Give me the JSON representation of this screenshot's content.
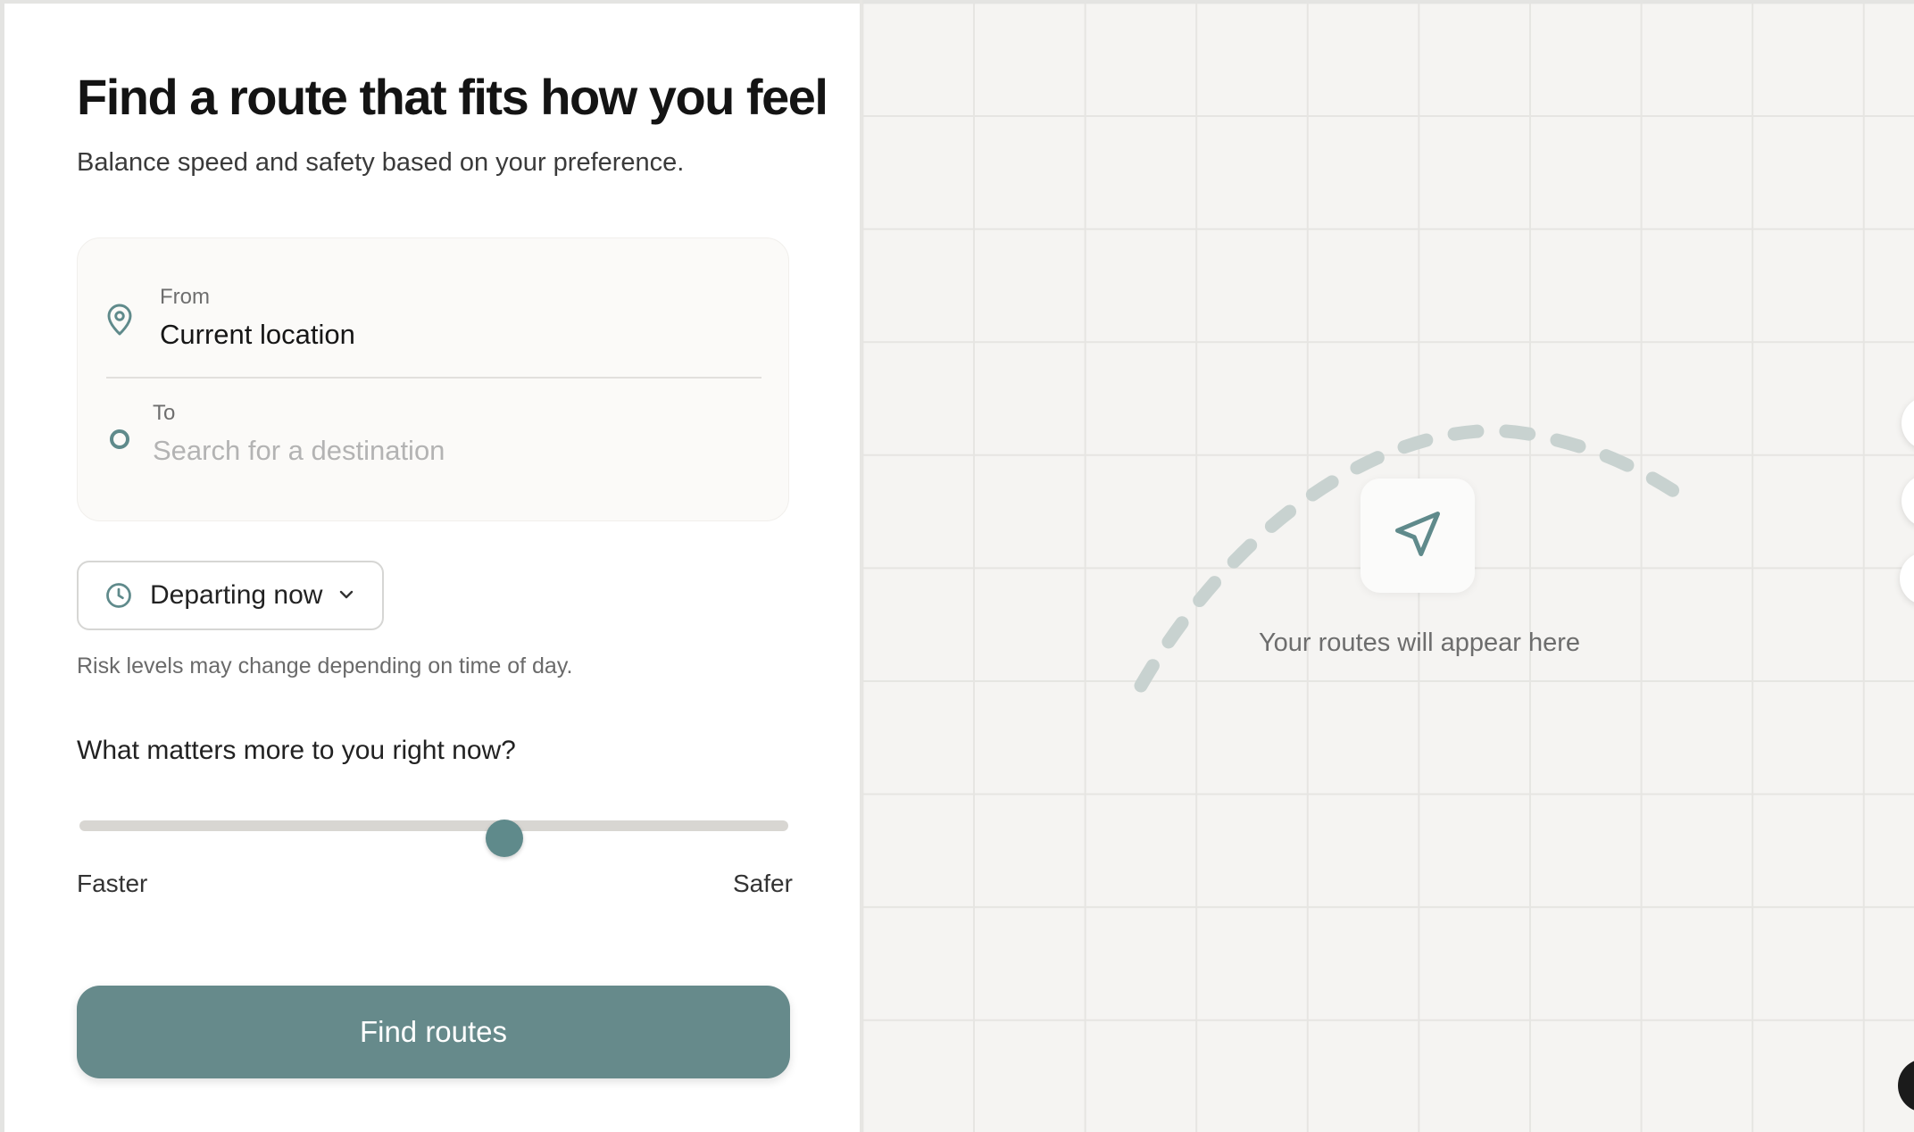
{
  "header": {
    "title": "Find a route that fits how you feel",
    "subtitle": "Balance speed and safety based on your preference."
  },
  "locations": {
    "from_label": "From",
    "from_value": "Current location",
    "to_label": "To",
    "to_placeholder": "Search for a destination",
    "icons": {
      "from": "location-pin-icon",
      "to": "destination-circle-icon"
    }
  },
  "departure": {
    "selected": "Departing now",
    "note": "Risk levels may change depending on time of day.",
    "icons": {
      "clock": "clock-icon",
      "chevron": "chevron-down-icon"
    }
  },
  "preference": {
    "question": "What matters more to you right now?",
    "min_label": "Faster",
    "max_label": "Safer",
    "value_fraction": 0.6
  },
  "actions": {
    "find_routes": "Find routes"
  },
  "map": {
    "empty_message": "Your routes will appear here",
    "icon": "navigation-arrow-icon"
  },
  "colors": {
    "accent": "#5f8a8b",
    "button": "#668a8b",
    "map_bg": "#f5f4f2",
    "route_dash": "#c8d2d0"
  }
}
